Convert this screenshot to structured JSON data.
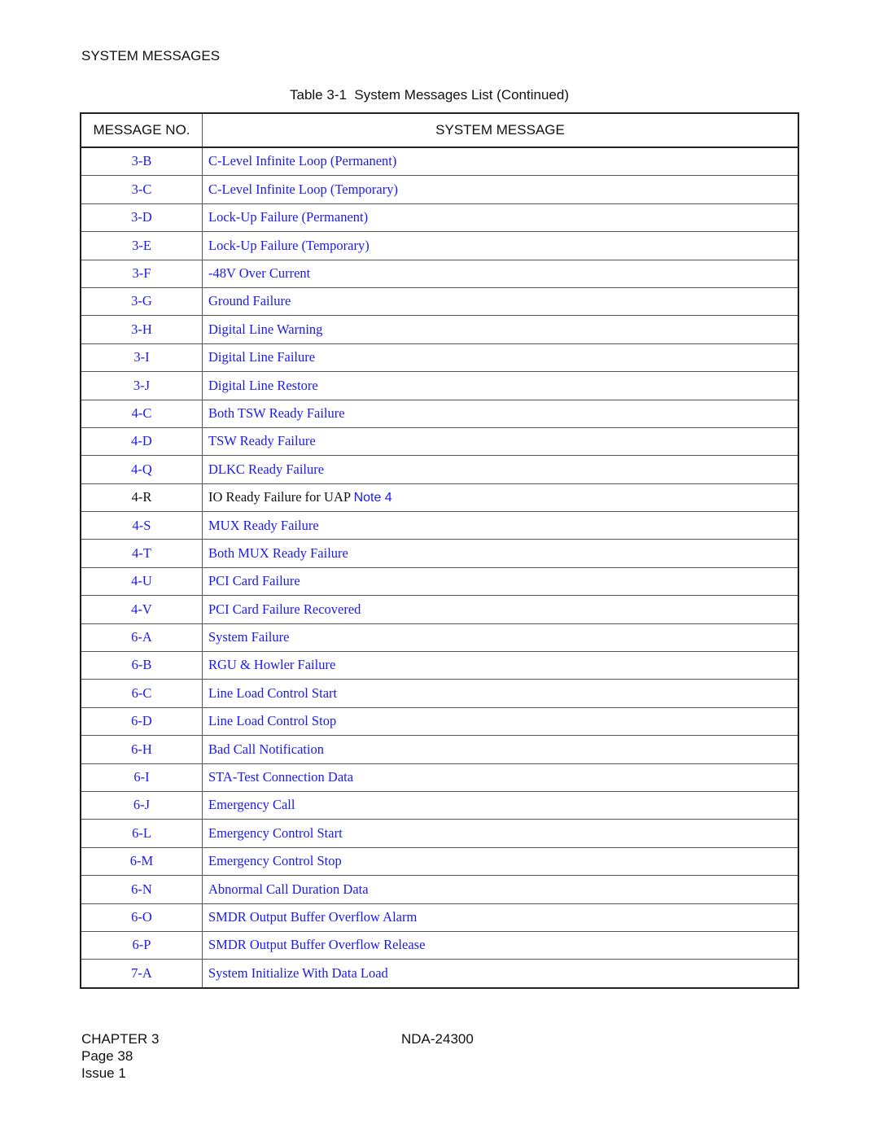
{
  "header": {
    "section_title": "SYSTEM MESSAGES",
    "table_caption": "Table 3-1  System Messages List (Continued)"
  },
  "table": {
    "columns": [
      "MESSAGE NO.",
      "SYSTEM MESSAGE"
    ],
    "link_color": "#1a1aee",
    "rows": [
      {
        "no": "3-B",
        "message": "C-Level Infinite Loop (Permanent)",
        "linked": true
      },
      {
        "no": "3-C",
        "message": "C-Level Infinite Loop (Temporary)",
        "linked": true
      },
      {
        "no": "3-D",
        "message": "Lock-Up Failure (Permanent)",
        "linked": true
      },
      {
        "no": "3-E",
        "message": "Lock-Up Failure (Temporary)",
        "linked": true
      },
      {
        "no": "3-F",
        "message": "-48V Over Current",
        "linked": true
      },
      {
        "no": "3-G",
        "message": "Ground Failure",
        "linked": true
      },
      {
        "no": "3-H",
        "message": "Digital Line Warning",
        "linked": true
      },
      {
        "no": "3-I",
        "message": "Digital Line Failure",
        "linked": true
      },
      {
        "no": "3-J",
        "message": "Digital Line Restore",
        "linked": true
      },
      {
        "no": "4-C",
        "message": "Both TSW Ready Failure",
        "linked": true
      },
      {
        "no": "4-D",
        "message": "TSW Ready Failure",
        "linked": true
      },
      {
        "no": "4-Q",
        "message": "DLKC Ready Failure",
        "linked": true
      },
      {
        "no": "4-R",
        "message": "IO Ready Failure for UAP",
        "linked": false,
        "note": "Note 4"
      },
      {
        "no": "4-S",
        "message": "MUX Ready Failure",
        "linked": true
      },
      {
        "no": "4-T",
        "message": "Both MUX Ready Failure",
        "linked": true
      },
      {
        "no": "4-U",
        "message": "PCI Card Failure",
        "linked": true
      },
      {
        "no": "4-V",
        "message": "PCI Card Failure Recovered",
        "linked": true
      },
      {
        "no": "6-A",
        "message": "System Failure",
        "linked": true
      },
      {
        "no": "6-B",
        "message": "RGU & Howler Failure",
        "linked": true
      },
      {
        "no": "6-C",
        "message": "Line Load Control Start",
        "linked": true
      },
      {
        "no": "6-D",
        "message": "Line Load Control Stop",
        "linked": true
      },
      {
        "no": "6-H",
        "message": "Bad Call Notification",
        "linked": true
      },
      {
        "no": "6-I",
        "message": "STA-Test Connection Data",
        "linked": true
      },
      {
        "no": "6-J",
        "message": "Emergency Call",
        "linked": true
      },
      {
        "no": "6-L",
        "message": "Emergency Control Start",
        "linked": true
      },
      {
        "no": "6-M",
        "message": "Emergency Control Stop",
        "linked": true
      },
      {
        "no": "6-N",
        "message": "Abnormal Call Duration Data",
        "linked": true
      },
      {
        "no": "6-O",
        "message": "SMDR Output Buffer Overflow Alarm",
        "linked": true
      },
      {
        "no": "6-P",
        "message": "SMDR Output Buffer Overflow Release",
        "linked": true
      },
      {
        "no": "7-A",
        "message": "System Initialize With Data Load",
        "linked": true
      }
    ]
  },
  "footer": {
    "chapter": "CHAPTER 3",
    "page": "Page 38",
    "issue": "Issue 1",
    "doc_number": "NDA-24300"
  }
}
